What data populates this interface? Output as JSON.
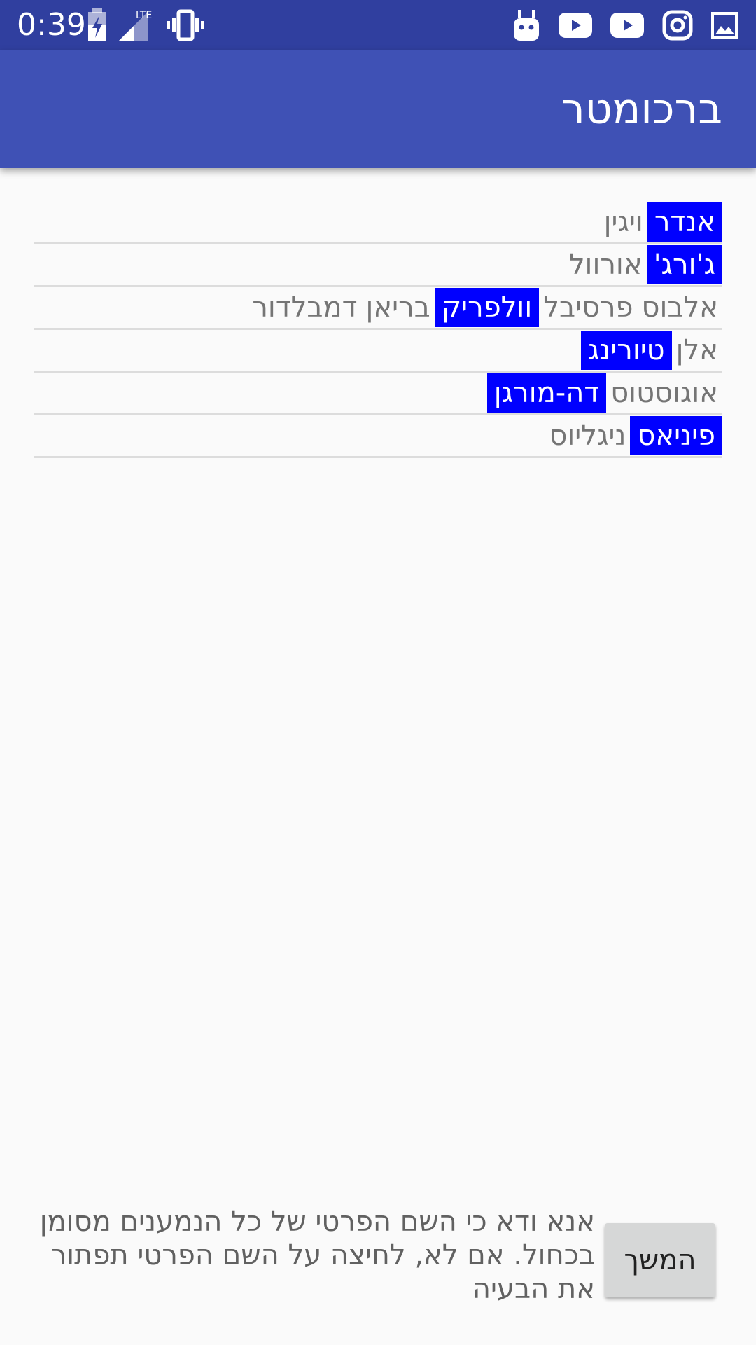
{
  "status_bar": {
    "time": "0:39",
    "left_icons": [
      "battery-charging-icon",
      "signal-lte-icon",
      "vibrate-icon"
    ],
    "lte_label": "LTE",
    "right_icons": [
      "android-debug-icon",
      "youtube-icon",
      "youtube-icon",
      "instagram-icon",
      "gallery-icon"
    ]
  },
  "app_bar": {
    "title": "ברכומטר"
  },
  "names": [
    {
      "words": [
        {
          "text": "אנדר",
          "highlighted": true
        },
        {
          "text": "ויגין",
          "highlighted": false
        }
      ]
    },
    {
      "words": [
        {
          "text": "ג'ורג'",
          "highlighted": true
        },
        {
          "text": "אורוול",
          "highlighted": false
        }
      ]
    },
    {
      "words": [
        {
          "text": "אלבוס",
          "highlighted": false
        },
        {
          "text": "פרסיבל",
          "highlighted": false
        },
        {
          "text": "וולפריק",
          "highlighted": true
        },
        {
          "text": "בריאן",
          "highlighted": false
        },
        {
          "text": "דמבלדור",
          "highlighted": false
        }
      ]
    },
    {
      "words": [
        {
          "text": "אלן",
          "highlighted": false
        },
        {
          "text": "טיורינג",
          "highlighted": true
        }
      ]
    },
    {
      "words": [
        {
          "text": "אוגוסטוס",
          "highlighted": false
        },
        {
          "text": "דה-מורגן",
          "highlighted": true
        }
      ]
    },
    {
      "words": [
        {
          "text": "פיניאס",
          "highlighted": true
        },
        {
          "text": "ניגליוס",
          "highlighted": false
        }
      ]
    }
  ],
  "footer": {
    "instruction": "אנא ודא כי השם הפרטי של כל הנמענים מסומן בכחול. אם לא, לחיצה על השם הפרטי תפתור את הבעיה",
    "continue_label": "המשך"
  },
  "colors": {
    "status_bar": "#303f9f",
    "app_bar": "#3f51b5",
    "highlight": "#0000ff",
    "background": "#fafafa"
  }
}
